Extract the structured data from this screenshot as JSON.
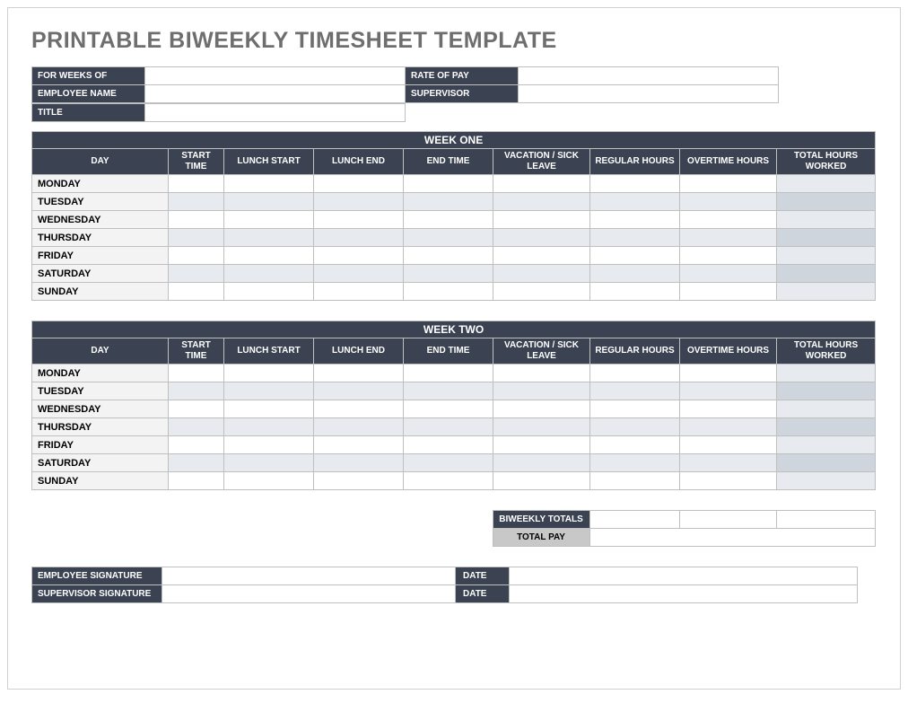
{
  "title": "PRINTABLE BIWEEKLY TIMESHEET TEMPLATE",
  "info": {
    "for_weeks_of": "FOR WEEKS OF",
    "employee_name": "EMPLOYEE NAME",
    "title_label": "TITLE",
    "rate_of_pay": "RATE OF PAY",
    "supervisor": "SUPERVISOR",
    "for_weeks_of_val": "",
    "employee_name_val": "",
    "title_val": "",
    "rate_of_pay_val": "",
    "supervisor_val": ""
  },
  "columns": {
    "day": "DAY",
    "start_time": "START TIME",
    "lunch_start": "LUNCH START",
    "lunch_end": "LUNCH END",
    "end_time": "END TIME",
    "vacation_sick": "VACATION / SICK LEAVE",
    "regular_hours": "REGULAR HOURS",
    "overtime_hours": "OVERTIME HOURS",
    "total_hours": "TOTAL HOURS WORKED"
  },
  "week_one": {
    "title": "WEEK ONE",
    "days": [
      {
        "name": "MONDAY"
      },
      {
        "name": "TUESDAY"
      },
      {
        "name": "WEDNESDAY"
      },
      {
        "name": "THURSDAY"
      },
      {
        "name": "FRIDAY"
      },
      {
        "name": "SATURDAY"
      },
      {
        "name": "SUNDAY"
      }
    ]
  },
  "week_two": {
    "title": "WEEK TWO",
    "days": [
      {
        "name": "MONDAY"
      },
      {
        "name": "TUESDAY"
      },
      {
        "name": "WEDNESDAY"
      },
      {
        "name": "THURSDAY"
      },
      {
        "name": "FRIDAY"
      },
      {
        "name": "SATURDAY"
      },
      {
        "name": "SUNDAY"
      }
    ]
  },
  "totals": {
    "biweekly_totals": "BIWEEKLY TOTALS",
    "total_pay": "TOTAL PAY",
    "reg_total": "",
    "ot_total": "",
    "hours_total": "",
    "pay_total": ""
  },
  "signatures": {
    "employee_signature": "EMPLOYEE SIGNATURE",
    "supervisor_signature": "SUPERVISOR SIGNATURE",
    "date_label": "DATE",
    "emp_sig_val": "",
    "sup_sig_val": "",
    "emp_date_val": "",
    "sup_date_val": ""
  }
}
